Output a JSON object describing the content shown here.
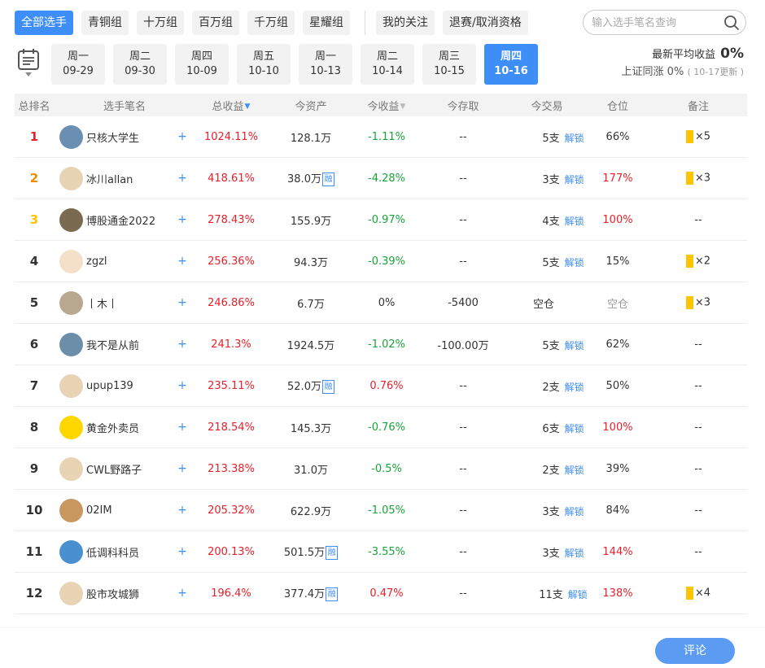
{
  "groups": [
    "全部选手",
    "青铜组",
    "十万组",
    "百万组",
    "千万组",
    "星耀组"
  ],
  "actions": [
    "我的关注",
    "退赛/取消资格"
  ],
  "search": {
    "placeholder": "输入选手笔名查询"
  },
  "dates": [
    {
      "day": "周一",
      "date": "09-29"
    },
    {
      "day": "周二",
      "date": "09-30"
    },
    {
      "day": "周四",
      "date": "10-09"
    },
    {
      "day": "周五",
      "date": "10-10"
    },
    {
      "day": "周一",
      "date": "10-13"
    },
    {
      "day": "周二",
      "date": "10-14"
    },
    {
      "day": "周三",
      "date": "10-15"
    },
    {
      "day": "周四",
      "date": "10-16"
    }
  ],
  "summary": {
    "avg_label": "最新平均收益",
    "avg_value": "0%",
    "index_text": "上证同涨 0%",
    "updated": "( 10-17更新 )"
  },
  "headers": {
    "rank": "总排名",
    "name": "选手笔名",
    "total": "总收益",
    "asset": "今资产",
    "today": "今收益",
    "access": "今存取",
    "trade": "今交易",
    "position": "仓位",
    "note": "备注"
  },
  "rows": [
    {
      "rank": "1",
      "name": "只核大学生",
      "total": "1024.11%",
      "asset": "128.1万",
      "rong": false,
      "today": "-1.11%",
      "today_c": "green",
      "access": "--",
      "trade": "5支",
      "unlock": "解锁",
      "pos": "66%",
      "pos_c": "n",
      "note": "×5",
      "note_bar": true
    },
    {
      "rank": "2",
      "name": "冰川allan",
      "total": "418.61%",
      "asset": "38.0万",
      "rong": true,
      "today": "-4.28%",
      "today_c": "green",
      "access": "--",
      "trade": "3支",
      "unlock": "解锁",
      "pos": "177%",
      "pos_c": "red",
      "note": "×3",
      "note_bar": true
    },
    {
      "rank": "3",
      "name": "博股通金2022",
      "total": "278.43%",
      "asset": "155.9万",
      "rong": false,
      "today": "-0.97%",
      "today_c": "green",
      "access": "--",
      "trade": "4支",
      "unlock": "解锁",
      "pos": "100%",
      "pos_c": "red",
      "note": "--",
      "note_bar": false
    },
    {
      "rank": "4",
      "name": "zgzl",
      "total": "256.36%",
      "asset": "94.3万",
      "rong": false,
      "today": "-0.39%",
      "today_c": "green",
      "access": "--",
      "trade": "5支",
      "unlock": "解锁",
      "pos": "15%",
      "pos_c": "n",
      "note": "×2",
      "note_bar": true
    },
    {
      "rank": "5",
      "name": "丨木丨",
      "total": "246.86%",
      "asset": "6.7万",
      "rong": false,
      "today": "0%",
      "today_c": "n",
      "access": "-5400",
      "trade": "空仓",
      "unlock": "",
      "pos": "空仓",
      "pos_c": "gray",
      "note": "×3",
      "note_bar": true
    },
    {
      "rank": "6",
      "name": "我不是从前",
      "total": "241.3%",
      "asset": "1924.5万",
      "rong": false,
      "today": "-1.02%",
      "today_c": "green",
      "access": "-100.00万",
      "trade": "5支",
      "unlock": "解锁",
      "pos": "62%",
      "pos_c": "n",
      "note": "--",
      "note_bar": false
    },
    {
      "rank": "7",
      "name": "upup139",
      "total": "235.11%",
      "asset": "52.0万",
      "rong": true,
      "today": "0.76%",
      "today_c": "red",
      "access": "--",
      "trade": "2支",
      "unlock": "解锁",
      "pos": "50%",
      "pos_c": "n",
      "note": "--",
      "note_bar": false
    },
    {
      "rank": "8",
      "name": "黄金外卖员",
      "total": "218.54%",
      "asset": "145.3万",
      "rong": false,
      "today": "-0.76%",
      "today_c": "green",
      "access": "--",
      "trade": "6支",
      "unlock": "解锁",
      "pos": "100%",
      "pos_c": "red",
      "note": "--",
      "note_bar": false
    },
    {
      "rank": "9",
      "name": "CWL野路子",
      "total": "213.38%",
      "asset": "31.0万",
      "rong": false,
      "today": "-0.5%",
      "today_c": "green",
      "access": "--",
      "trade": "2支",
      "unlock": "解锁",
      "pos": "39%",
      "pos_c": "n",
      "note": "--",
      "note_bar": false
    },
    {
      "rank": "10",
      "name": "02IM",
      "total": "205.32%",
      "asset": "622.9万",
      "rong": false,
      "today": "-1.05%",
      "today_c": "green",
      "access": "--",
      "trade": "3支",
      "unlock": "解锁",
      "pos": "84%",
      "pos_c": "n",
      "note": "--",
      "note_bar": false
    },
    {
      "rank": "11",
      "name": "低调科科员",
      "total": "200.13%",
      "asset": "501.5万",
      "rong": true,
      "today": "-3.55%",
      "today_c": "green",
      "access": "--",
      "trade": "3支",
      "unlock": "解锁",
      "pos": "144%",
      "pos_c": "red",
      "note": "--",
      "note_bar": false
    },
    {
      "rank": "12",
      "name": "股市攻城狮",
      "total": "196.4%",
      "asset": "377.4万",
      "rong": true,
      "today": "0.47%",
      "today_c": "red",
      "access": "--",
      "trade": "11支",
      "unlock": "解锁",
      "pos": "138%",
      "pos_c": "red",
      "note": "×4",
      "note_bar": true
    }
  ],
  "rong_label": "融",
  "comment": "评论",
  "colors": {
    "accent": "#3e8ef7",
    "up": "#e5212b",
    "down": "#18a33a",
    "note": "#ffc400"
  }
}
